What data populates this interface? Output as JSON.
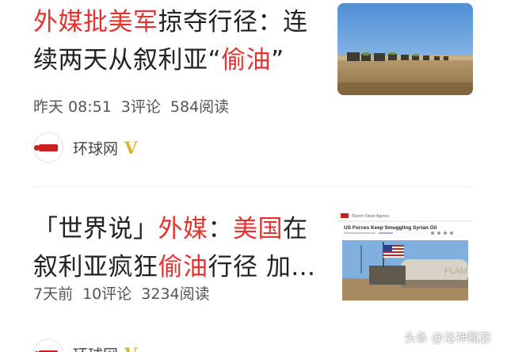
{
  "feed": {
    "items": [
      {
        "title_segments": [
          "外媒批美军",
          "掠夺行径：连续两天从叙利亚“",
          "偷油",
          "”"
        ],
        "meta": {
          "time": "昨天 08:51",
          "comments": "3评论",
          "reads": "584阅读"
        },
        "source": {
          "name": "环球网",
          "verified_badge": "V"
        },
        "thumbnail": {
          "icon": "image-convoy-desert-photo"
        }
      },
      {
        "title_segments": [
          "「世界说」",
          "外媒",
          "：",
          "美国",
          "在叙利亚疯狂",
          "偷油",
          "行径 加..."
        ],
        "meta": {
          "time": "7天前",
          "comments": "10评论",
          "reads": "3234阅读"
        },
        "source": {
          "name": "环球网",
          "verified_badge": "V"
        },
        "thumbnail": {
          "icon": "image-news-article-photo",
          "site_name": "Tasnim News Agency",
          "headline": "US Forces Keep Smuggling Syrian Oil",
          "truck_text": "FLAM"
        }
      }
    ]
  },
  "watermark": "头条 @洛神甄宓",
  "colors": {
    "accent_red": "#e6322e",
    "text": "#222222",
    "meta": "#555555",
    "verified": "#e0b22c"
  }
}
